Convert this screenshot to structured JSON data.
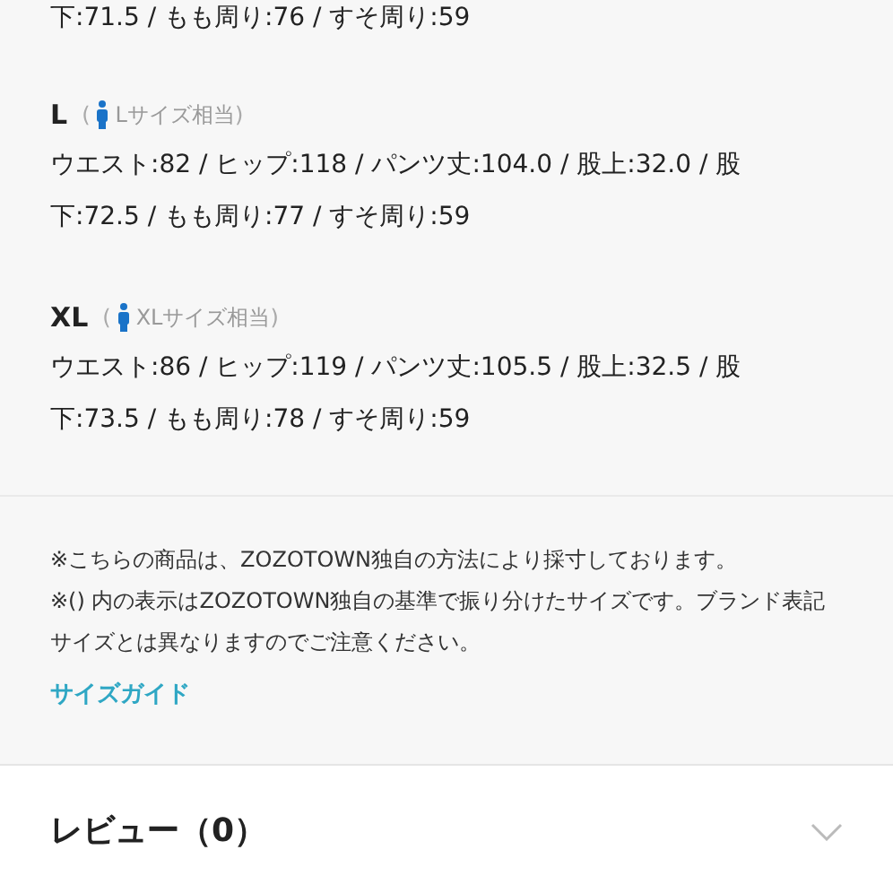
{
  "top_line": "下:71.5 / もも周り:76 / すそ周り:59",
  "sizes": [
    {
      "label": "L",
      "paren_open": "(",
      "equivalent": "Lサイズ相当",
      "paren_close": ")",
      "measurements": "ウエスト:82 / ヒップ:118 / パンツ丈:104.0 / 股上:32.0 / 股下:72.5 / もも周り:77 / すそ周り:59"
    },
    {
      "label": "XL",
      "paren_open": "(",
      "equivalent": "XLサイズ相当",
      "paren_close": ")",
      "measurements": "ウエスト:86 / ヒップ:119 / パンツ丈:105.5 / 股上:32.5 / 股下:73.5 / もも周り:78 / すそ周り:59"
    }
  ],
  "notes": [
    "※こちらの商品は、ZOZOTOWN独自の方法により採寸しております。",
    "※() 内の表示はZOZOTOWN独自の基準で振り分けたサイズです。ブランド表記サイズとは異なりますのでご注意ください。"
  ],
  "size_guide_link": "サイズガイド",
  "review": {
    "title": "レビュー（0）",
    "expanded": false
  }
}
